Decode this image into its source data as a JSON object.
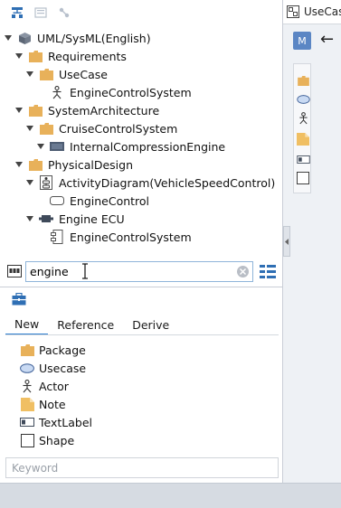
{
  "tree": {
    "items": [
      {
        "label": "UML/SysML(English)",
        "icon": "model-icon",
        "depth": 0
      },
      {
        "label": "Requirements",
        "icon": "package-icon",
        "depth": 1
      },
      {
        "label": "UseCase",
        "icon": "package-icon",
        "depth": 2
      },
      {
        "label": "EngineControlSystem",
        "icon": "actor-icon",
        "depth": 3
      },
      {
        "label": "SystemArchitecture",
        "icon": "package-icon",
        "depth": 1
      },
      {
        "label": "CruiseControlSystem",
        "icon": "package-icon",
        "depth": 2
      },
      {
        "label": "InternalCompressionEngine",
        "icon": "block-icon",
        "depth": 3
      },
      {
        "label": "PhysicalDesign",
        "icon": "package-icon",
        "depth": 1
      },
      {
        "label": "ActivityDiagram(VehicleSpeedControl)",
        "icon": "activity-diagram-icon",
        "depth": 2
      },
      {
        "label": "EngineControl",
        "icon": "action-icon",
        "depth": 3
      },
      {
        "label": "Engine ECU",
        "icon": "node-icon",
        "depth": 2
      },
      {
        "label": "EngineControlSystem",
        "icon": "component-icon",
        "depth": 3
      }
    ]
  },
  "search": {
    "value": "engine",
    "placeholder": ""
  },
  "palette": {
    "tabs": [
      {
        "label": "New"
      },
      {
        "label": "Reference"
      },
      {
        "label": "Derive"
      }
    ],
    "items": [
      {
        "label": "Package",
        "icon": "package-icon"
      },
      {
        "label": "Usecase",
        "icon": "usecase-icon"
      },
      {
        "label": "Actor",
        "icon": "actor-icon"
      },
      {
        "label": "Note",
        "icon": "note-icon"
      },
      {
        "label": "TextLabel",
        "icon": "textlabel-icon"
      },
      {
        "label": "Shape",
        "icon": "shape-icon"
      }
    ],
    "keyword_placeholder": "Keyword"
  },
  "editor": {
    "tab_title": "UseCas",
    "badge": "M",
    "back": "←"
  },
  "colors": {
    "accent": "#2f7fd0",
    "folder": "#e8b15a",
    "badge": "#5b86c4"
  }
}
